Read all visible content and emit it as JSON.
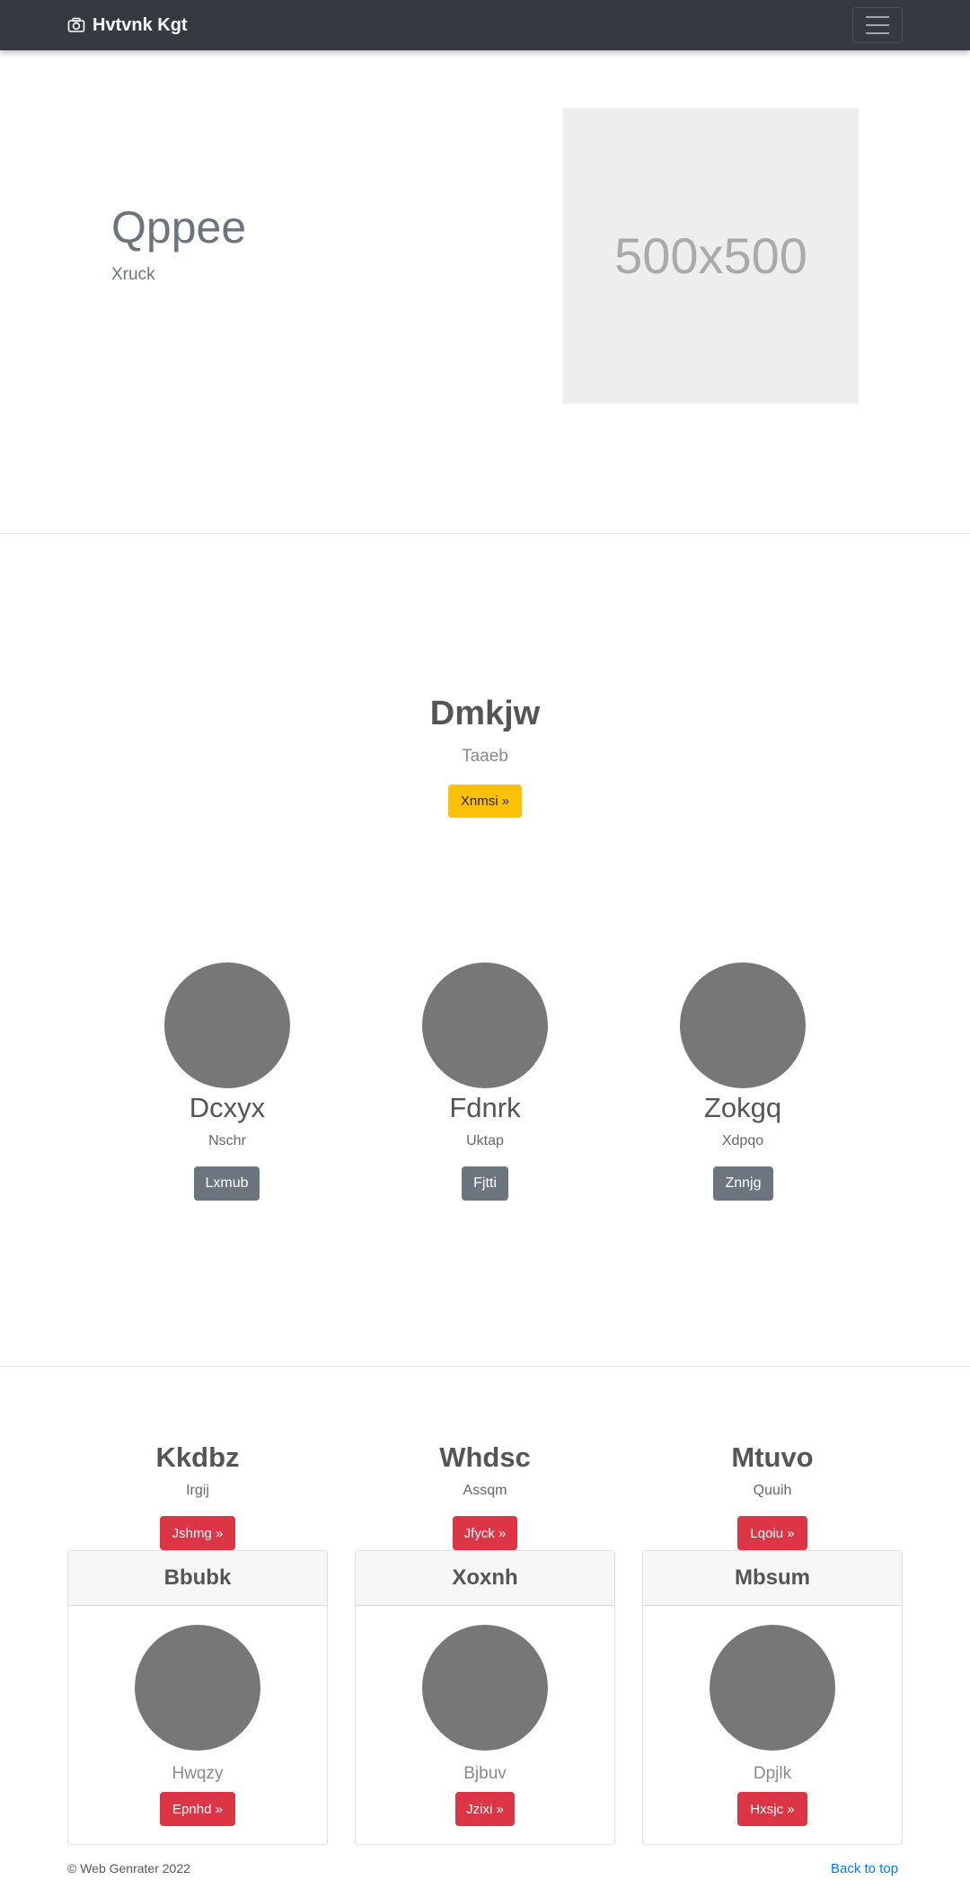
{
  "navbar": {
    "brand": "Hvtvnk Kgt",
    "brand_icon": "camera-icon",
    "toggler_icon": "hamburger-icon"
  },
  "hero": {
    "title": "Qppee",
    "subtitle": "Xruck",
    "placeholder": "500x500"
  },
  "feature": {
    "title": "Dmkjw",
    "subtitle": "Taaeb",
    "button": "Xnmsi »"
  },
  "circles": [
    {
      "title": "Dcxyx",
      "subtitle": "Nschr",
      "button": "Lxmub"
    },
    {
      "title": "Fdnrk",
      "subtitle": "Uktap",
      "button": "Fjtti"
    },
    {
      "title": "Zokgq",
      "subtitle": "Xdpqo",
      "button": "Znnjg"
    }
  ],
  "columns": [
    {
      "title": "Kkdbz",
      "subtitle": "Irgij",
      "button": "Jshmg »"
    },
    {
      "title": "Whdsc",
      "subtitle": "Assqm",
      "button": "Jfyck »"
    },
    {
      "title": "Mtuvo",
      "subtitle": "Quuih",
      "button": "Lqoiu »"
    }
  ],
  "cards": [
    {
      "header": "Bbubk",
      "text": "Hwqzy",
      "button": "Epnhd »"
    },
    {
      "header": "Xoxnh",
      "text": "Bjbuv",
      "button": "Jzixi »"
    },
    {
      "header": "Mbsum",
      "text": "Dpjlk",
      "button": "Hxsjc »"
    }
  ],
  "footer": {
    "copyright": "© Web Genrater 2022",
    "back_to_top": "Back to top"
  },
  "colors": {
    "navbar": "#343a40",
    "warning": "#ffc107",
    "secondary": "#6c757d",
    "danger": "#dc3545",
    "link": "#007bff"
  }
}
